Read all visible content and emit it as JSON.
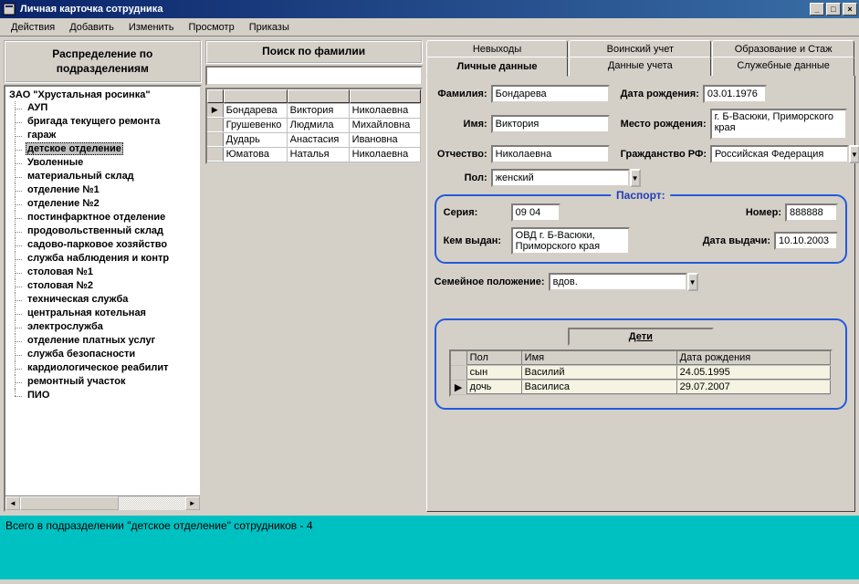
{
  "window": {
    "title": "Личная карточка сотрудника"
  },
  "menu": {
    "items": [
      "Действия",
      "Добавить",
      "Изменить",
      "Просмотр",
      "Приказы"
    ]
  },
  "tree": {
    "header": "Распределение по подразделениям",
    "root": "ЗАО \"Хрустальная росинка\"",
    "items": [
      "АУП",
      "бригада текущего ремонта",
      "гараж",
      "детское отделение",
      "Уволенные",
      "материальный склад",
      "отделение №1",
      "отделение №2",
      "постинфарктное отделение",
      "продовольственный склад",
      "садово-парковое хозяйство",
      "служба наблюдения и контр",
      "столовая №1",
      "столовая №2",
      "техническая служба",
      "центральная котельная",
      "электрослужба",
      "отделение платных услуг",
      "служба безопасности",
      "кардиологическое реабилит",
      "ремонтный участок",
      "ПИО"
    ],
    "selected_index": 3
  },
  "search": {
    "header": "Поиск по фамилии",
    "value": "",
    "rows": [
      [
        "Бондарева",
        "Виктория",
        "Николаевна"
      ],
      [
        "Грушевенко",
        "Людмила",
        "Михайловна"
      ],
      [
        "Дударь",
        "Анастасия",
        "Ивановна"
      ],
      [
        "Юматова",
        "Наталья",
        "Николаевна"
      ]
    ],
    "selected_row": 0
  },
  "tabs": {
    "row1": [
      "Невыходы",
      "Воинский учет",
      "Образование и Стаж"
    ],
    "row2": [
      "Личные данные",
      "Данные учета",
      "Служебные данные"
    ],
    "active": "Личные данные"
  },
  "personal": {
    "labels": {
      "surname": "Фамилия:",
      "name": "Имя:",
      "patronymic": "Отчество:",
      "sex": "Пол:",
      "birthdate": "Дата рождения:",
      "birthplace": "Место рождения:",
      "citizenship": "Гражданство РФ:",
      "marital": "Семейное положение:"
    },
    "surname": "Бондарева",
    "name": "Виктория",
    "patronymic": "Николаевна",
    "sex": "женский",
    "birthdate": "03.01.1976",
    "birthplace": "г. Б-Васюки, Приморского края",
    "citizenship": "Российская Федерация",
    "marital": "вдов."
  },
  "passport": {
    "title": "Паспорт:",
    "labels": {
      "series": "Серия:",
      "number": "Номер:",
      "issued_by": "Кем выдан:",
      "issue_date": "Дата выдачи:"
    },
    "series": "09 04",
    "number": "888888",
    "issued_by": "ОВД г. Б-Васюки, Приморского края",
    "issue_date": "10.10.2003"
  },
  "children": {
    "title": "Дети",
    "columns": [
      "Пол",
      "Имя",
      "Дата рождения"
    ],
    "rows": [
      {
        "sex": "сын",
        "name": "Василий",
        "dob": "24.05.1995"
      },
      {
        "sex": "дочь",
        "name": "Василиса",
        "dob": "29.07.2007"
      }
    ],
    "selected_row": 1
  },
  "status": "Всего в подразделении \"детское отделение\" сотрудников - 4"
}
